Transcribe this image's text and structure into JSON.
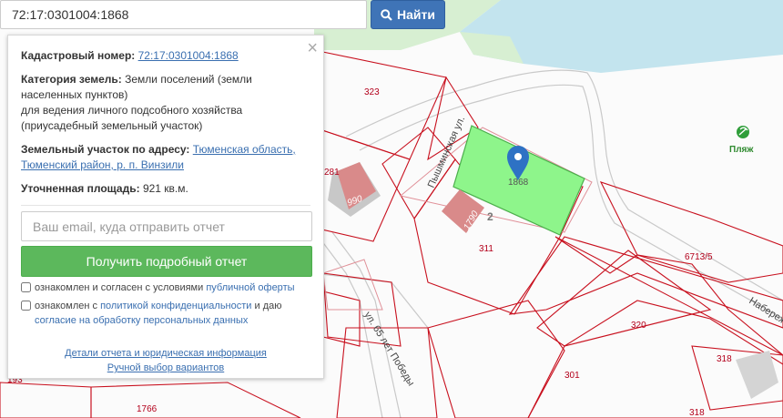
{
  "search": {
    "value": "72:17:0301004:1868",
    "button_label": "Найти"
  },
  "panel": {
    "close_glyph": "×",
    "cadastral_label": "Кадастровый номер:",
    "cadastral_number": "72:17:0301004:1868",
    "category_label": "Категория земель:",
    "category_line1": "Земли поселений (земли",
    "category_line2": "населенных пунктов)",
    "category_line3": "для ведения личного подсобного хозяйства",
    "category_line4": "(приусадебный земельный участок)",
    "address_label": "Земельный участок по адресу:",
    "address_line1": "Тюменская область,",
    "address_line2": "Тюменский район, р. п. Винзили",
    "area_label": "Уточненная площадь:",
    "area_value": "921 кв.м.",
    "email_placeholder": "Ваш email, куда отправить отчет",
    "report_button": "Получить подробный отчет",
    "terms_prefix": "ознакомлен и согласен с условиями",
    "terms_link": "публичной оферты",
    "privacy_prefix": "ознакомлен с",
    "privacy_link": "политикой конфиденциальности",
    "privacy_mid": "и даю",
    "consent_link": "согласие на обработку персональных данных",
    "details_link": "Детали отчета и юридическая информация",
    "manual_link": "Ручной выбор вариантов"
  },
  "map": {
    "parcel_numbers": [
      "323",
      "281",
      "990",
      "1868",
      "1790",
      "2",
      "311",
      "6713/5",
      "320",
      "301",
      "318",
      "318",
      "1766",
      "193"
    ],
    "streets": [
      "Пышминская ул.",
      "ул. 65 лет Победы",
      "Набереж"
    ],
    "poi": {
      "label": "Пляж",
      "icon": "beach-icon"
    },
    "colors": {
      "parcel_border": "#c8101e",
      "selected_fill": "#8ef58b",
      "water": "#bfe3f0",
      "grass": "#d6efd0",
      "building": "#d98a8a",
      "pin": "#2e72c4"
    }
  }
}
